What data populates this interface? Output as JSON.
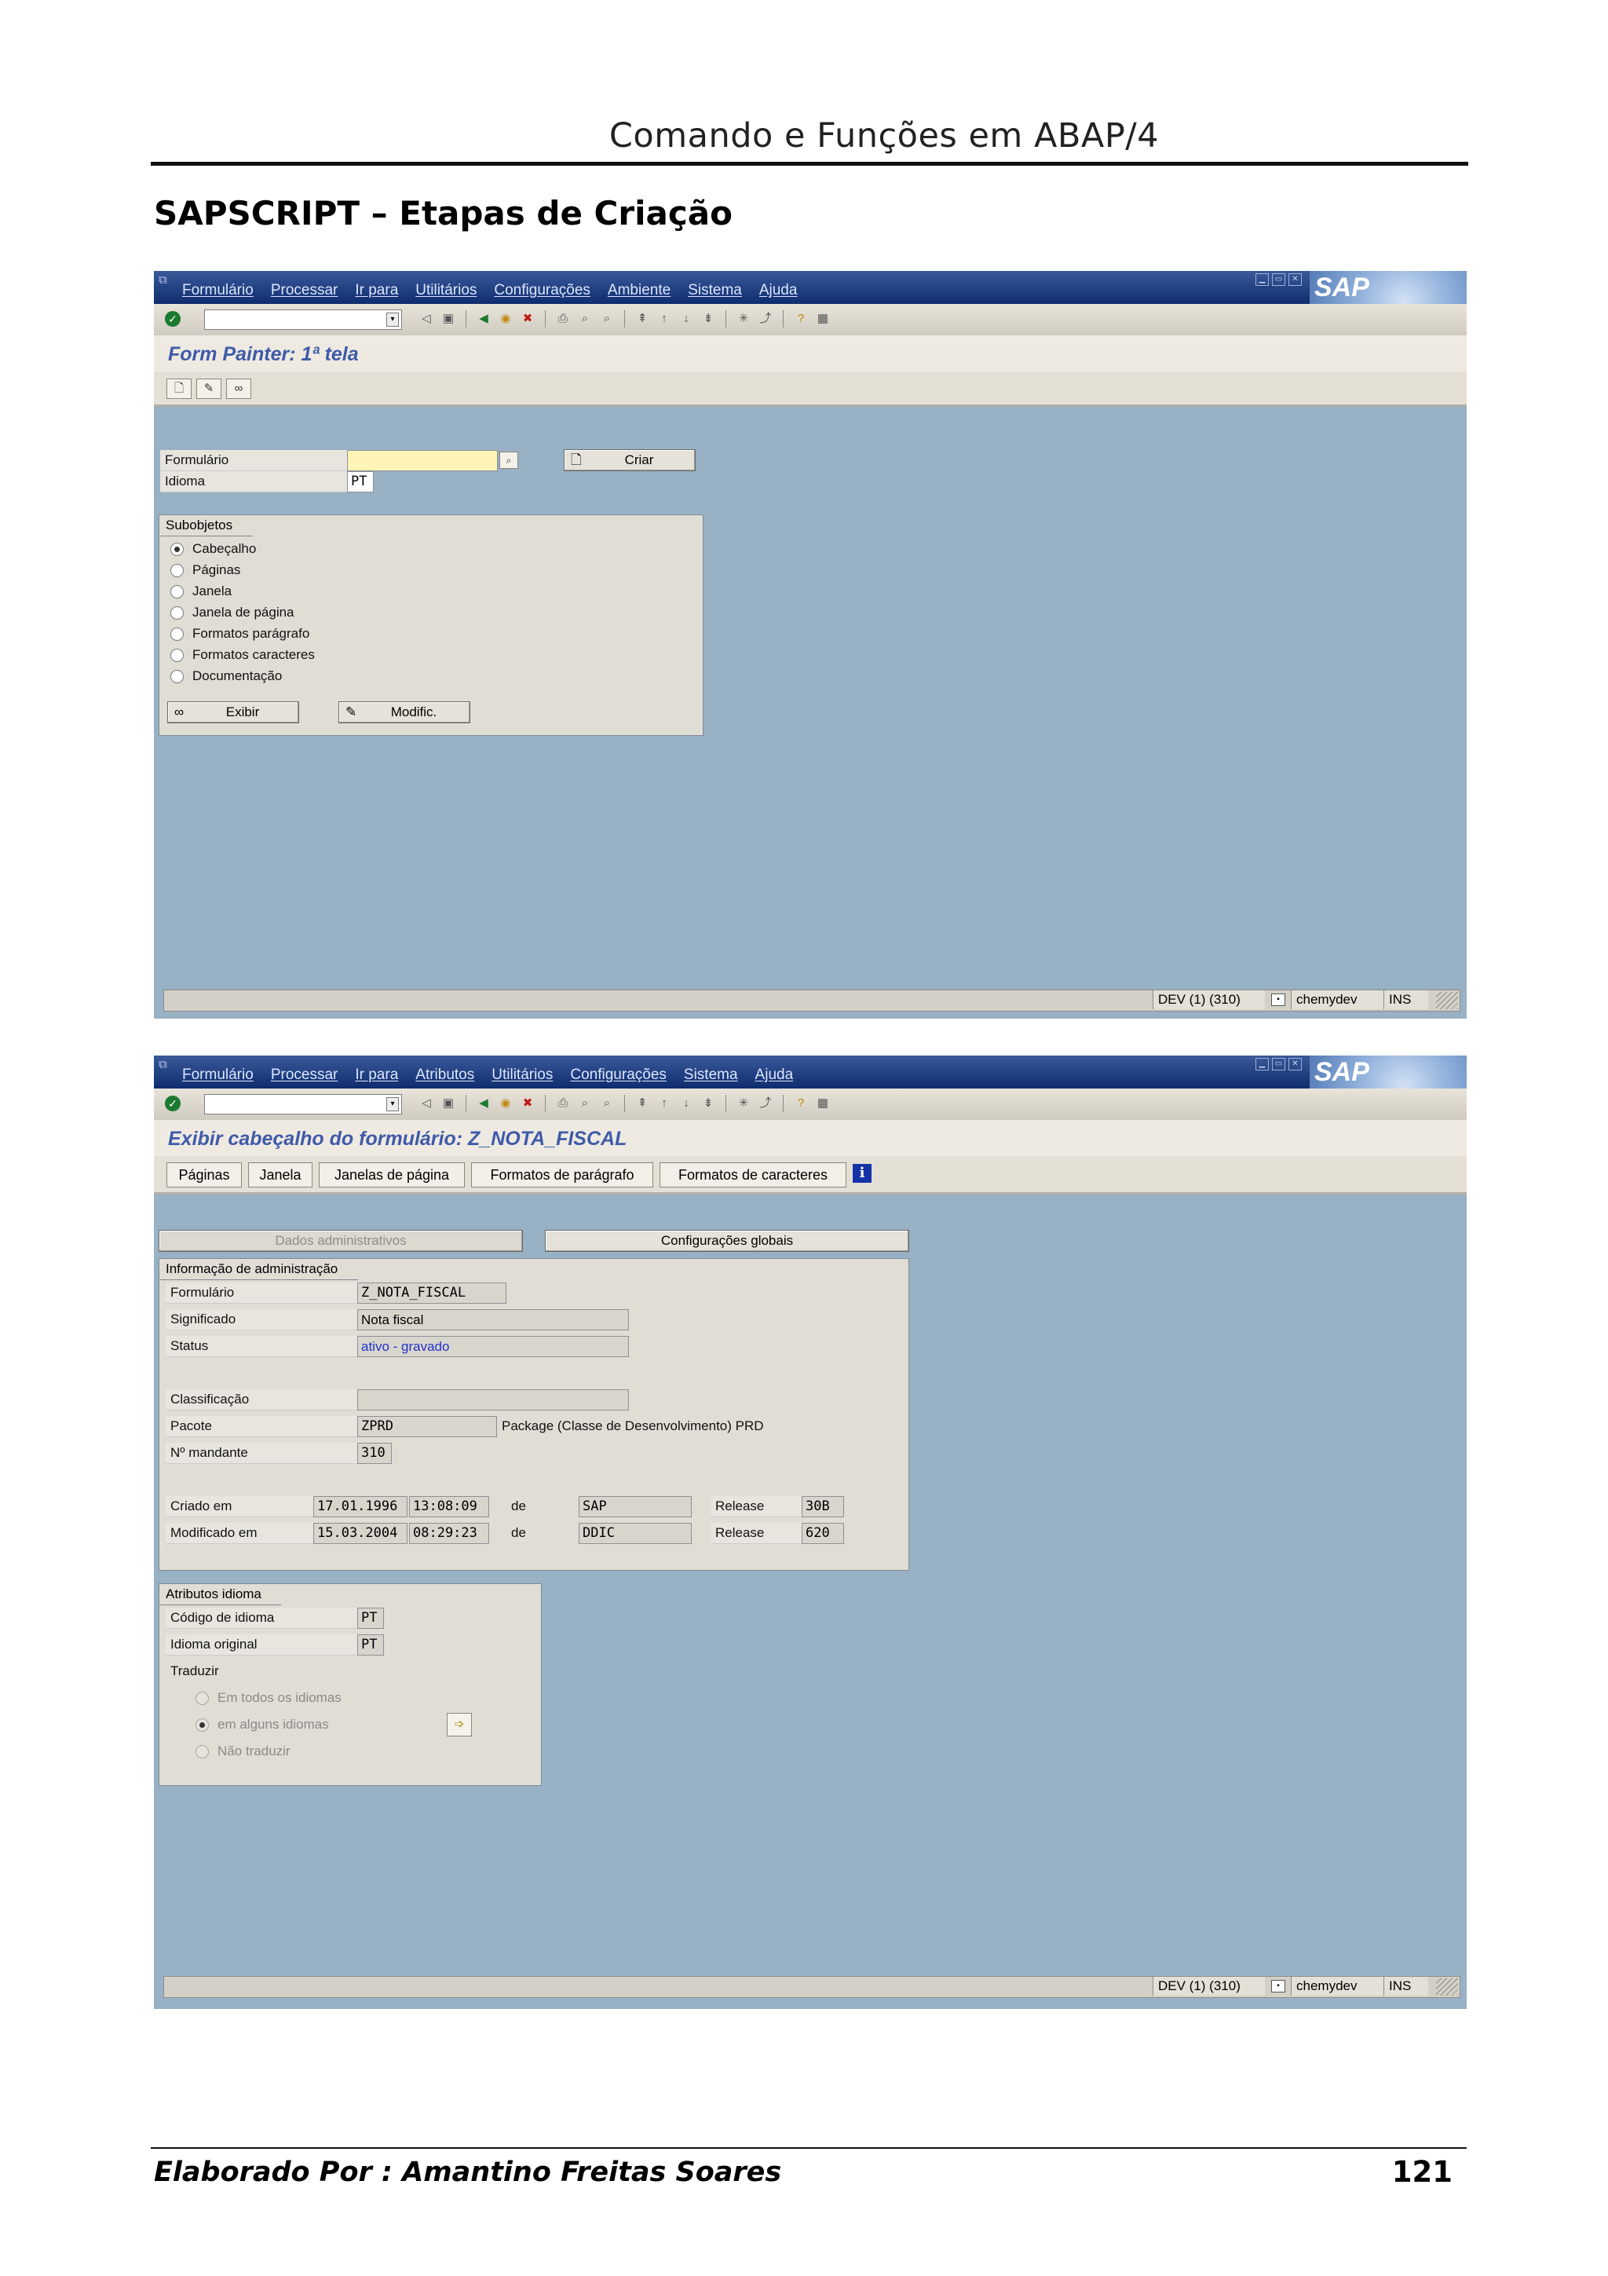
{
  "document": {
    "header_title": "Comando e Funções em ABAP/4",
    "section_title": "SAPSCRIPT – Etapas de Criação",
    "footer_author": "Elaborado Por : Amantino Freitas Soares",
    "page_number": "121"
  },
  "sap_common": {
    "logo_text": "SAP",
    "status": {
      "system": "DEV (1) (310)",
      "server": "chemydev",
      "mode": "INS"
    }
  },
  "screen1": {
    "menu": [
      "Formulário",
      "Processar",
      "Ir para",
      "Utilitários",
      "Configurações",
      "Ambiente",
      "Sistema",
      "Ajuda"
    ],
    "title": "Form Painter: 1ª tela",
    "formulario_label": "Formulário",
    "formulario_value": "",
    "idioma_label": "Idioma",
    "idioma_value": "PT",
    "criar_button": "Criar",
    "subobjetos_title": "Subobjetos",
    "subobjetos": [
      "Cabeçalho",
      "Páginas",
      "Janela",
      "Janela de página",
      "Formatos parágrafo",
      "Formatos caracteres",
      "Documentação"
    ],
    "subobjeto_selected": "Cabeçalho",
    "exibir_button": "Exibir",
    "modific_button": "Modific."
  },
  "screen2": {
    "menu": [
      "Formulário",
      "Processar",
      "Ir para",
      "Atributos",
      "Utilitários",
      "Configurações",
      "Sistema",
      "Ajuda"
    ],
    "title": "Exibir cabeçalho do formulário: Z_NOTA_FISCAL",
    "app_buttons": [
      "Páginas",
      "Janela",
      "Janelas de página",
      "Formatos de parágrafo",
      "Formatos de caracteres"
    ],
    "tab_admin": "Dados administrativos",
    "tab_global": "Configurações globais",
    "admin_group_title": "Informação de administração",
    "formulario_label": "Formulário",
    "formulario_value": "Z_NOTA_FISCAL",
    "significado_label": "Significado",
    "significado_value": "Nota fiscal",
    "status_label": "Status",
    "status_value": "ativo - gravado",
    "classificacao_label": "Classificação",
    "classificacao_value": "",
    "pacote_label": "Pacote",
    "pacote_value": "ZPRD",
    "pacote_desc": "Package (Classe de Desenvolvimento) PRD",
    "mandante_label": "Nº mandante",
    "mandante_value": "310",
    "criado_label": "Criado em",
    "criado_date": "17.01.1996",
    "criado_time": "13:08:09",
    "criado_de": "de",
    "criado_user": "SAP",
    "criado_release_label": "Release",
    "criado_release": "30B",
    "modif_label": "Modificado em",
    "modif_date": "15.03.2004",
    "modif_time": "08:29:23",
    "modif_de": "de",
    "modif_user": "DDIC",
    "modif_release_label": "Release",
    "modif_release": "620",
    "idioma_group_title": "Atributos idioma",
    "codigo_idioma_label": "Código de idioma",
    "codigo_idioma_value": "PT",
    "idioma_original_label": "Idioma original",
    "idioma_original_value": "PT",
    "traduzir_label": "Traduzir",
    "traduzir_options": [
      "Em todos os idiomas",
      "em alguns idiomas",
      "Não traduzir"
    ],
    "traduzir_selected": "em alguns idiomas"
  },
  "colors": {
    "sap_background": "#98b1c4",
    "menubar": "#0e2c6e",
    "title_text": "#3f5aa8",
    "status_value_text": "#2233cc"
  }
}
